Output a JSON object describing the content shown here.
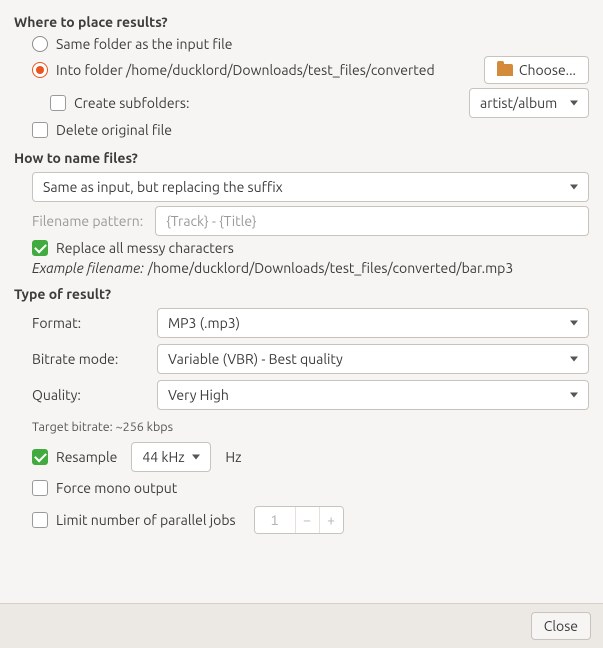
{
  "placement": {
    "title": "Where to place results?",
    "same_folder_label": "Same folder as the input file",
    "into_folder_label": "Into folder /home/ducklord/Downloads/test_files/converted",
    "choose_btn": "Choose...",
    "create_subfolders_label": "Create subfolders:",
    "subfolder_pattern": "artist/album",
    "delete_original_label": "Delete original file"
  },
  "naming": {
    "title": "How to name files?",
    "mode": "Same as input, but replacing the suffix",
    "pattern_label": "Filename pattern:",
    "pattern_value": "{Track} - {Title}",
    "replace_messy_label": "Replace all messy characters",
    "example_prefix": "Example filename:",
    "example_path": "/home/ducklord/Downloads/test_files/converted/bar.mp3"
  },
  "result": {
    "title": "Type of result?",
    "format_label": "Format:",
    "format_value": "MP3 (.mp3)",
    "bitrate_mode_label": "Bitrate mode:",
    "bitrate_mode_value": "Variable (VBR) - Best quality",
    "quality_label": "Quality:",
    "quality_value": "Very High",
    "target_bitrate": "Target bitrate: ~256 kbps",
    "resample_label": "Resample",
    "resample_value": "44 kHz",
    "resample_unit": "Hz",
    "force_mono_label": "Force mono output",
    "limit_jobs_label": "Limit number of parallel jobs",
    "limit_jobs_value": "1"
  },
  "footer": {
    "close": "Close"
  }
}
